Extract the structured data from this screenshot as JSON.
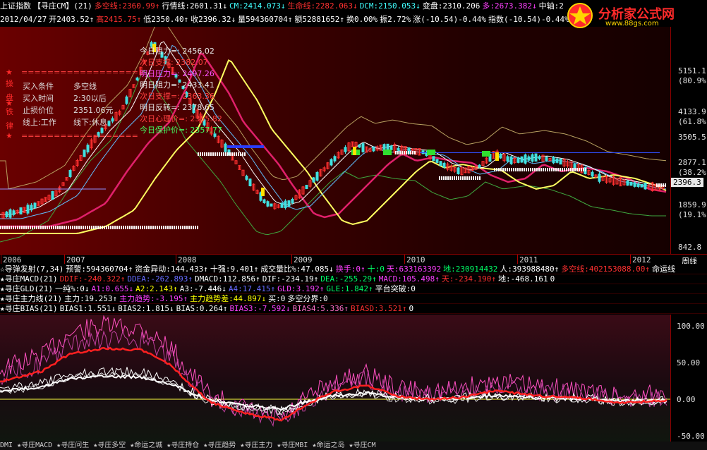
{
  "header": {
    "row1": [
      {
        "t": "上证指数",
        "c": "white"
      },
      {
        "t": "【寻庄CM】(21)",
        "c": "white"
      },
      {
        "t": "多空线:2360.99↑",
        "c": "red"
      },
      {
        "t": "行情线:2601.31↓",
        "c": "white"
      },
      {
        "t": "CM:2414.073↓",
        "c": "cyan"
      },
      {
        "t": "生命线:2282.063↓",
        "c": "red"
      },
      {
        "t": "DCM:2150.053↓",
        "c": "cyan"
      },
      {
        "t": "变盘:2310.206",
        "c": "white"
      },
      {
        "t": "多:2673.382↓",
        "c": "magenta"
      },
      {
        "t": "中轴:2",
        "c": "white"
      }
    ],
    "row2": [
      {
        "t": "2012/04/27",
        "c": "white"
      },
      {
        "t": "开2403.52↑",
        "c": "white"
      },
      {
        "t": "高2415.75↑",
        "c": "red"
      },
      {
        "t": "低2350.40↑",
        "c": "white"
      },
      {
        "t": "收2396.32↓",
        "c": "white"
      },
      {
        "t": "量594360704↑",
        "c": "white"
      },
      {
        "t": "额52881652↑",
        "c": "white"
      },
      {
        "t": "换0.00%",
        "c": "white"
      },
      {
        "t": "振2.72%",
        "c": "white"
      },
      {
        "t": "涨(-10.54)-0.44%",
        "c": "white"
      },
      {
        "t": "指数(-10.54)-0.44%",
        "c": "white"
      }
    ]
  },
  "logo": {
    "title": "分析家公式网",
    "url": "www.88gs.com",
    "icon": "star-badge-icon"
  },
  "info_box": {
    "side_label": "操盘铁律",
    "divider": "==================",
    "items": [
      {
        "k": "买入条件",
        "v": "多空线"
      },
      {
        "k": "买入时间",
        "v": "2:30以后"
      },
      {
        "k": "止损价位",
        "v": "2351.06元"
      },
      {
        "k": "线上:工作",
        "v": "线下:休息"
      }
    ]
  },
  "levels": [
    {
      "t": "今日阻力=: 2456.02",
      "c": "white"
    },
    {
      "t": "次日支撑: 2382.07",
      "c": "red"
    },
    {
      "t": "明日压力=: 2497.26",
      "c": "magenta"
    },
    {
      "t": "明日阻力=: 2433.41",
      "c": "white"
    },
    {
      "t": "次日支撑=: 2363.36",
      "c": "red"
    },
    {
      "t": "明日反转=: 2378.65",
      "c": "white"
    },
    {
      "t": "次日心理价=: 2355.82",
      "c": "red"
    },
    {
      "t": "今日保护价=: 2357.77",
      "c": "green"
    }
  ],
  "price_axis": [
    {
      "t": "5151.1",
      "pct": "(80.9%)"
    },
    {
      "t": "4133.9",
      "pct": "(61.8%)"
    },
    {
      "t": "3505.5",
      "pct": ""
    },
    {
      "t": "2877.1",
      "pct": "(38.2%)"
    },
    {
      "t": "1859.9",
      "pct": "(19.1%)"
    },
    {
      "t": "842.8",
      "pct": ""
    }
  ],
  "current_price": "2396.3",
  "timeline": [
    "2006",
    "2007",
    "2008",
    "2009",
    "2010",
    "2011",
    "2012"
  ],
  "period_label": "周线",
  "indicators": [
    [
      {
        "t": "☆导弹发射(7,34)",
        "c": "white"
      },
      {
        "t": "预警:594360704↑",
        "c": "white"
      },
      {
        "t": "资金异动:144.433↑",
        "c": "white"
      },
      {
        "t": "十强:9.401↑",
        "c": "white"
      },
      {
        "t": "成交量比%:47.085↓",
        "c": "white"
      },
      {
        "t": "换手:0↑",
        "c": "magenta"
      },
      {
        "t": "十:0",
        "c": "green"
      },
      {
        "t": "天:633163392",
        "c": "magenta"
      },
      {
        "t": "地:230914432",
        "c": "green"
      },
      {
        "t": "人:393988480↑",
        "c": "white"
      },
      {
        "t": "多空线:402153088.00↑",
        "c": "red"
      },
      {
        "t": "命运线",
        "c": "white"
      }
    ],
    [
      {
        "t": "★寻庄MACD(21)",
        "c": "white"
      },
      {
        "t": "DDIF:-240.322↑",
        "c": "red"
      },
      {
        "t": "DDEA:-262.893↑",
        "c": "blue"
      },
      {
        "t": "DMACD:112.856↑",
        "c": "white"
      },
      {
        "t": "DIF:-234.19↑",
        "c": "white"
      },
      {
        "t": "DEA:-255.29↑",
        "c": "green"
      },
      {
        "t": "MACD:105.498↑",
        "c": "magenta"
      },
      {
        "t": "天:-234.190↑",
        "c": "red"
      },
      {
        "t": "地:-468.161",
        "c": "white"
      },
      {
        "t": "0",
        "c": "white"
      }
    ],
    [
      {
        "t": "★寻庄GLD(21)",
        "c": "white"
      },
      {
        "t": "一纯%:0↓",
        "c": "white"
      },
      {
        "t": "A1:0.655↓",
        "c": "magenta"
      },
      {
        "t": "A2:2.143↑",
        "c": "yellow"
      },
      {
        "t": "A3:-7.446↓",
        "c": "white"
      },
      {
        "t": "A4:17.415↑",
        "c": "blue"
      },
      {
        "t": "GLD:3.192↑",
        "c": "magenta"
      },
      {
        "t": "GLE:1.842↑",
        "c": "green"
      },
      {
        "t": "平台突破:0",
        "c": "white"
      }
    ],
    [
      {
        "t": "★寻庄主力线(21)",
        "c": "white"
      },
      {
        "t": "主力:19.253↑",
        "c": "white"
      },
      {
        "t": "主力趋势:-3.195↑",
        "c": "magenta"
      },
      {
        "t": "主力趋势差:44.897↓",
        "c": "yellow"
      },
      {
        "t": "买:0",
        "c": "white"
      },
      {
        "t": "多空分界:0",
        "c": "white"
      }
    ],
    [
      {
        "t": "★寻庄BIAS(21)",
        "c": "white"
      },
      {
        "t": "BIAS1:1.551↓",
        "c": "white"
      },
      {
        "t": "BIAS2:1.815↓",
        "c": "white"
      },
      {
        "t": "BIAS:0.264↑",
        "c": "white"
      },
      {
        "t": "BIAS3:-7.592↓",
        "c": "magenta"
      },
      {
        "t": "BIAS4:5.336↑",
        "c": "pink"
      },
      {
        "t": "BIASD:3.521↑",
        "c": "red"
      },
      {
        "t": "0",
        "c": "white"
      }
    ]
  ],
  "bias_axis": [
    "100.00",
    "50.00",
    "0.00",
    "-50.00"
  ],
  "bottom_tabs": [
    "DMI",
    "★寻庄MACD",
    "★寻庄问生",
    "★寻庄多空",
    "★命运之城",
    "★寻庄持仓",
    "★寻庄趋势",
    "★寻庄主力",
    "★寻庄MBI",
    "★命运之岛",
    "★寻庄CM"
  ],
  "colors": {
    "price_bg": "#4a0000",
    "accent": "#ff3030",
    "yellow_line": "#ffff60",
    "magenta_line": "#e0206a"
  }
}
